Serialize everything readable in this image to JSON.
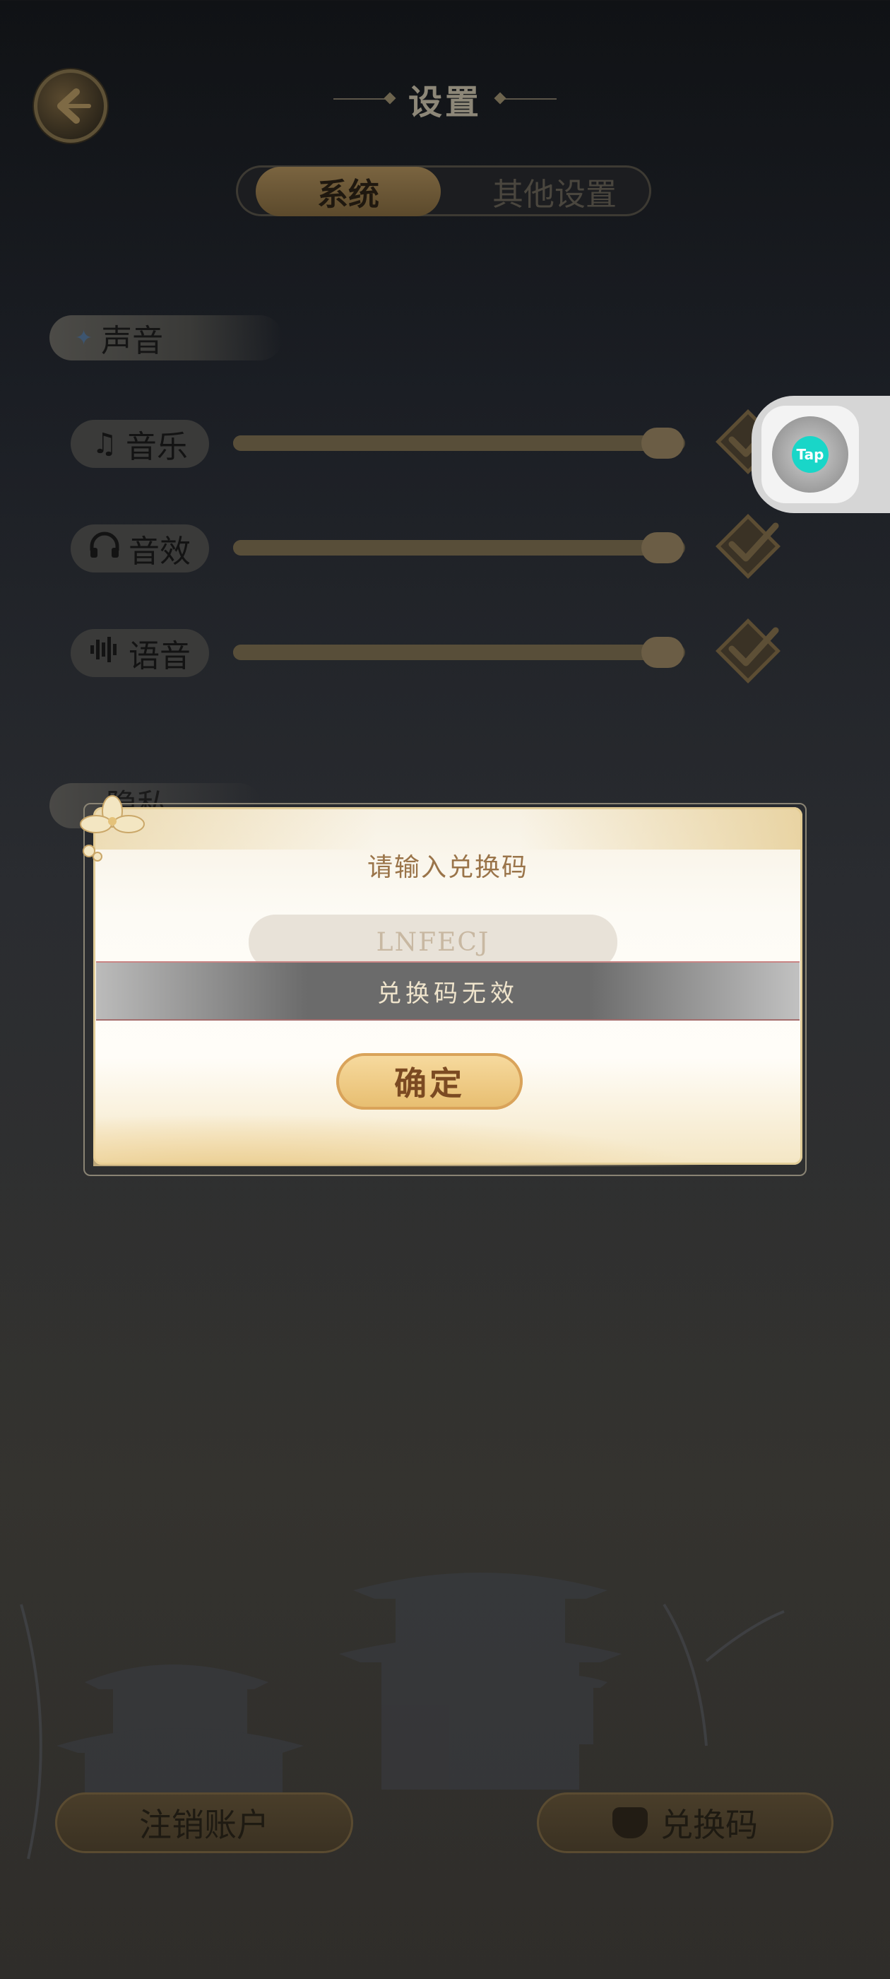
{
  "header": {
    "title": "设置"
  },
  "tabs": [
    {
      "label": "系统",
      "active": true
    },
    {
      "label": "其他设置",
      "active": false
    }
  ],
  "sound": {
    "section_label": "声音",
    "rows": [
      {
        "label": "音乐",
        "icon": "music-note-icon",
        "volume_fraction": 0.95,
        "enabled": true
      },
      {
        "label": "音效",
        "icon": "headphones-icon",
        "volume_fraction": 0.95,
        "enabled": true
      },
      {
        "label": "语音",
        "icon": "voice-wave-icon",
        "volume_fraction": 0.95,
        "enabled": true
      }
    ]
  },
  "privacy": {
    "section_label": "隐私"
  },
  "floating": {
    "label": "Tap"
  },
  "dialog": {
    "title": "请输入兑换码",
    "code_value": "LNFECJ",
    "toast": "兑换码无效",
    "confirm_label": "确定"
  },
  "footer": {
    "logout_label": "注销账户",
    "redeem_label": "兑换码"
  },
  "colors": {
    "accent_gold": "#e7bd6f",
    "dialog_bg": "#fffdf8",
    "tap_brand": "#19d6c8"
  }
}
